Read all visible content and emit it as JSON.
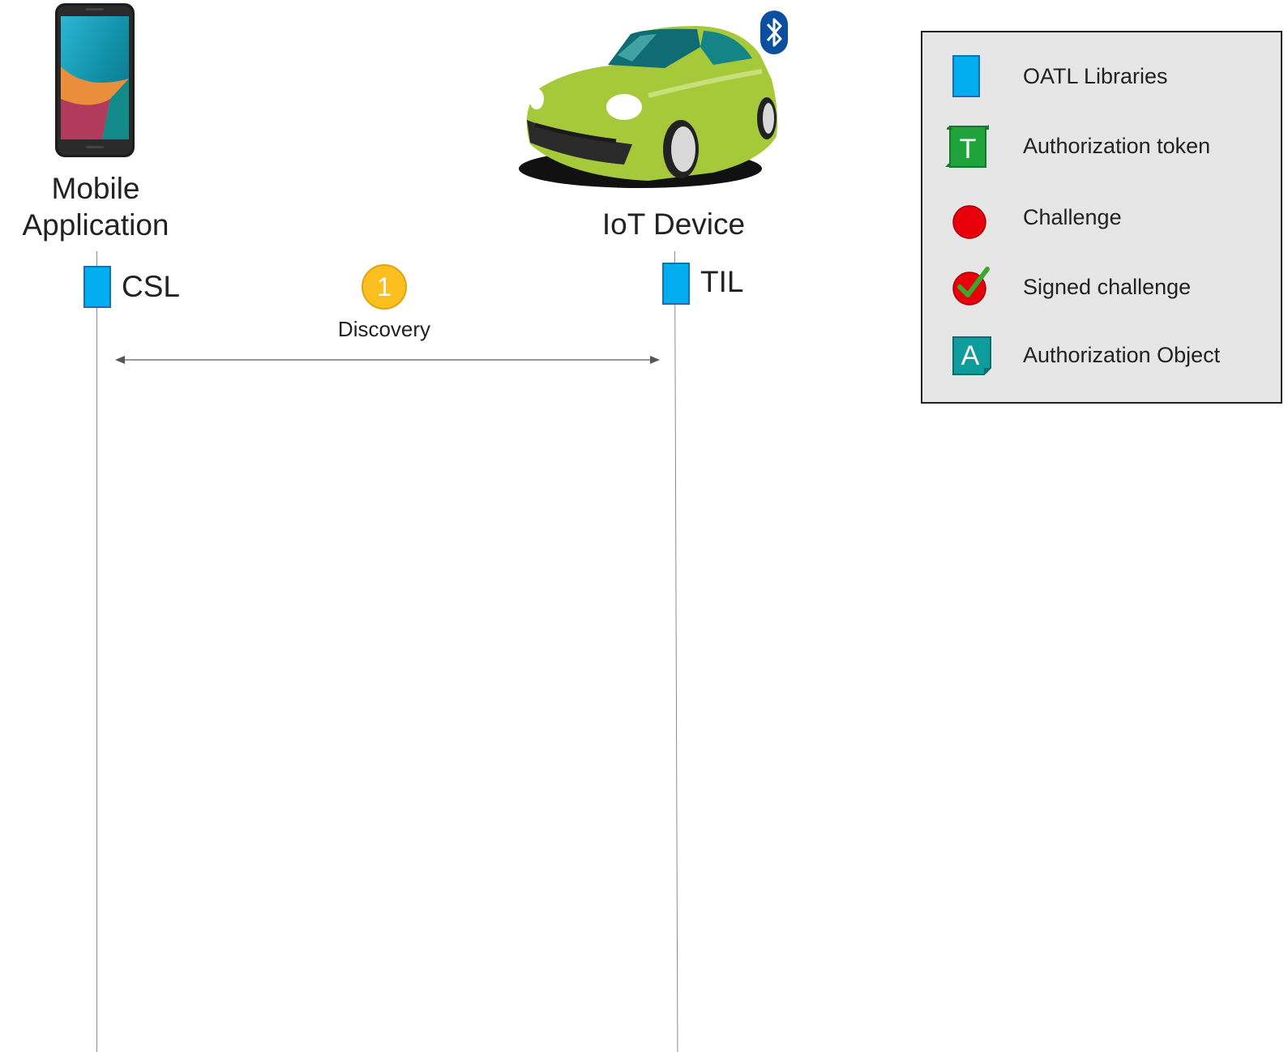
{
  "actors": {
    "mobile": {
      "label_line1": "Mobile",
      "label_line2": "Application",
      "library": "CSL",
      "icon": "smartphone-icon"
    },
    "iot": {
      "label": "IoT Device",
      "library": "TIL",
      "icon": "car-icon",
      "badge_icon": "bluetooth-icon"
    }
  },
  "messages": [
    {
      "step": "1",
      "label": "Discovery",
      "direction": "bidirectional",
      "from": "Mobile Application",
      "to": "IoT Device"
    }
  ],
  "legend": {
    "items": [
      {
        "icon": "oatl-library-icon",
        "label": "OATL Libraries"
      },
      {
        "icon": "authorization-token-icon",
        "icon_letter": "T",
        "label": "Authorization token"
      },
      {
        "icon": "challenge-icon",
        "label": "Challenge"
      },
      {
        "icon": "signed-challenge-icon",
        "label": "Signed challenge"
      },
      {
        "icon": "authorization-object-icon",
        "icon_letter": "A",
        "label": "Authorization Object"
      }
    ]
  },
  "colors": {
    "library": "#00aeef",
    "token": "#1fa33a",
    "challenge": "#e8000b",
    "check": "#3aa82a",
    "auth_object": "#0e9c9c",
    "step_badge": "#fbbf1f",
    "car_body": "#a6c93a",
    "bluetooth": "#0b4fa0",
    "legend_bg": "#e6e6e6"
  }
}
